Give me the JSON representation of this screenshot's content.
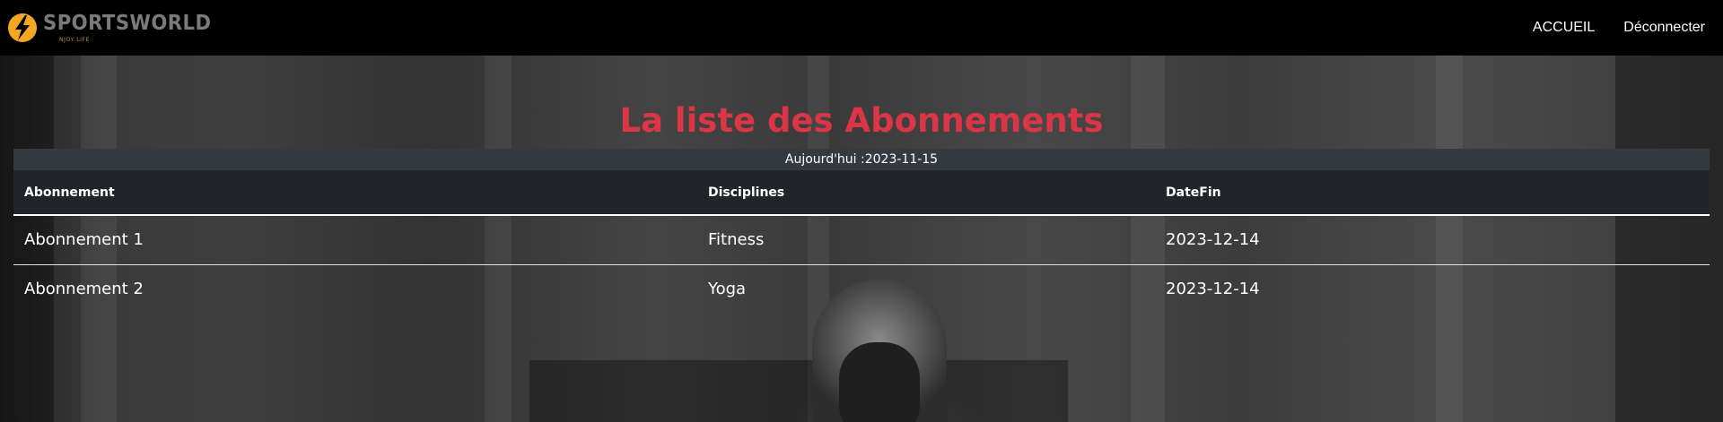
{
  "brand": {
    "name": "SPORTSWORLD",
    "tagline": "NJOY LIFE",
    "logo_icon": "lightning-bolt-circle-icon",
    "accent_color": "#f5a623"
  },
  "nav": {
    "items": [
      {
        "label": "ACCUEIL"
      },
      {
        "label": "Déconnecter"
      }
    ]
  },
  "main": {
    "title": "La liste des Abonnements",
    "title_color": "#dc3545",
    "today_label": "Aujourd'hui :2023-11-15",
    "table": {
      "columns": [
        "Abonnement",
        "Disciplines",
        "DateFin"
      ],
      "rows": [
        [
          "Abonnement 1",
          "Fitness",
          "2023-12-14"
        ],
        [
          "Abonnement 2",
          "Yoga",
          "2023-12-14"
        ]
      ]
    }
  }
}
